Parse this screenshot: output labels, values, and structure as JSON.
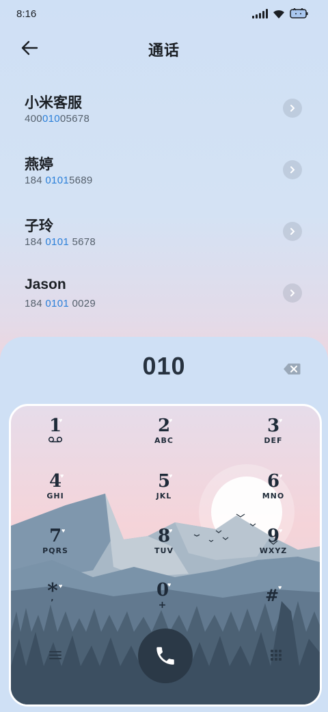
{
  "status_bar": {
    "time": "8:16",
    "icons": [
      "signal-icon",
      "wifi-icon",
      "battery-icon"
    ]
  },
  "header": {
    "title": "通话",
    "back_icon": "back-arrow-icon"
  },
  "contacts": [
    {
      "name": "小米客服",
      "number_parts": [
        "400",
        "010",
        "05678"
      ]
    },
    {
      "name": "燕婷",
      "number_parts": [
        "184 ",
        "0101",
        "5689"
      ]
    },
    {
      "name": "子玲",
      "number_parts": [
        "184 ",
        "0101",
        " 5678"
      ]
    },
    {
      "name": "Jason",
      "number_parts": [
        "184 ",
        "0101",
        " 0029"
      ]
    }
  ],
  "dialer": {
    "typed_number": "010",
    "backspace_icon": "backspace-icon",
    "keys": [
      {
        "digit": "1",
        "letters": ""
      },
      {
        "digit": "2",
        "letters": "ABC"
      },
      {
        "digit": "3",
        "letters": "DEF"
      },
      {
        "digit": "4",
        "letters": "GHI"
      },
      {
        "digit": "5",
        "letters": "JKL"
      },
      {
        "digit": "6",
        "letters": "MNO"
      },
      {
        "digit": "7",
        "letters": "PQRS"
      },
      {
        "digit": "8",
        "letters": "TUV"
      },
      {
        "digit": "9",
        "letters": "WXYZ"
      },
      {
        "digit": "*",
        "letters": ","
      },
      {
        "digit": "0",
        "letters": "+"
      },
      {
        "digit": "#",
        "letters": ""
      }
    ],
    "call_icon": "phone-icon",
    "menu_icon": "menu-icon",
    "keypad_toggle_icon": "dialpad-icon"
  },
  "colors": {
    "highlight": "#2a7fd9",
    "call_button": "#2b3947",
    "background": "#cfe0f5"
  }
}
